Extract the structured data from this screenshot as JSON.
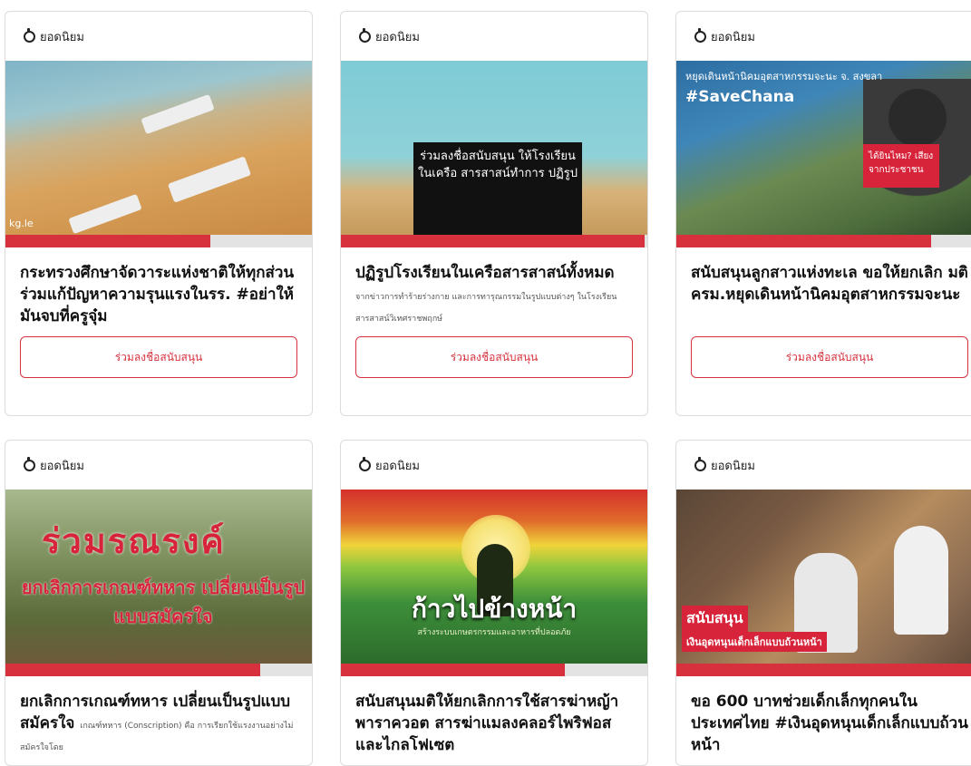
{
  "popular_label": "ยอดนิยม",
  "support_label": "ร่วมลงชื่อสนับสนุน",
  "colors": {
    "accent": "#d7313e",
    "track": "#e3e3e3"
  },
  "cards": [
    {
      "title": "กระทรวงศึกษาจัดวาระแห่งชาติให้ทุกส่วนร่วมแก้ปัญหาความรุนแรงในรร. #อย่าให้มันจบที่ครูจุ๋ม",
      "desc": "",
      "progress": 0.67,
      "image_text": "kg.le"
    },
    {
      "title": "ปฏิรูปโรงเรียนในเครือสารสาสน์ทั้งหมด",
      "desc": "จากข่าวการทำร้ายร่างกาย และการทารุณกรรมในรูปแบบต่างๆ ในโรงเรียนสารสาสน์วิเทศราชพฤกษ์",
      "progress": 0.99,
      "image_text": "ร่วมลงชื่อสนับสนุน ให้โรงเรียนในเครือ สารสาสน์ทำการ ปฏิรูป"
    },
    {
      "title": "สนับสนุนลูกสาวแห่งทะเล ขอให้ยกเลิก มติ ครม.หยุดเดินหน้านิคมอุตสาหกรรมจะนะ",
      "desc": "",
      "progress": 0.83,
      "image_text": "หยุดเดินหน้านิคมอุตสาหกรรมจะนะ จ. สงขลา",
      "image_tag": "#SaveChana",
      "image_sign": "ได้ยินไหม? เสียงจากประชาชน"
    },
    {
      "title": "ยกเลิกการเกณฑ์ทหาร เปลี่ยนเป็นรูปแบบสมัครใจ",
      "desc": "เกณฑ์ทหาร (Conscription) คือ การเรียกใช้แรงงานอย่างไม่สมัครใจโดย",
      "progress": 0.83,
      "image_text": "ร่วมรณรงค์",
      "image_sub": "ยกเลิกการเกณฑ์ทหาร เปลี่ยนเป็นรูปแบบสมัครใจ"
    },
    {
      "title": "สนับสนุนมติให้ยกเลิกการใช้สารฆ่าหญ้าพาราควอต สารฆ่าแมลงคลอร์ไพริฟอส และไกลโฟเซต",
      "desc": "",
      "progress": 0.73,
      "image_text": "ก้าวไปข้างหน้า",
      "image_sub": "สร้างระบบเกษตรกรรมและอาหารที่ปลอดภัย"
    },
    {
      "title": "ขอ 600 บาทช่วยเด็กเล็กทุกคนในประเทศไทย #เงินอุดหนุนเด็กเล็กแบบถ้วนหน้า",
      "desc": "",
      "progress": 0.99,
      "image_text": "สนับสนุน",
      "image_sub": "เงินอุดหนุนเด็กเล็กแบบถ้วนหน้า"
    }
  ]
}
